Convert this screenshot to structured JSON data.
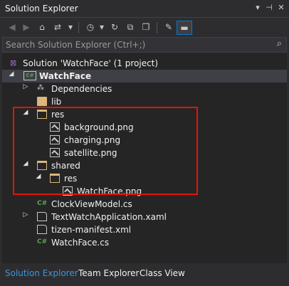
{
  "window": {
    "title": "Solution Explorer",
    "controls": [
      "▾",
      "⊣",
      "✕"
    ]
  },
  "toolbar": {
    "buttons": [
      "back-icon",
      "forward-icon",
      "home-icon",
      "sync-icon",
      "history-icon",
      "undo-icon",
      "collapse-all-icon",
      "copy-icon",
      "show-all-icon",
      "properties-icon",
      "preview-icon"
    ]
  },
  "search": {
    "placeholder": "Search Solution Explorer (Ctrl+;)",
    "icon": "search-icon"
  },
  "tree": {
    "solution": "Solution 'WatchFace' (1 project)",
    "project": "WatchFace",
    "dependencies": "Dependencies",
    "lib": "lib",
    "res": "res",
    "background": "background.png",
    "charging": "charging.png",
    "satellite": "satellite.png",
    "shared": "shared",
    "shared_res": "res",
    "shared_watchface": "WatchFace.png",
    "clockviewmodel": "ClockViewModel.cs",
    "textwatchapp": "TextWatchApplication.xaml",
    "manifest": "tizen-manifest.xml",
    "watchface_cs": "WatchFace.cs",
    "cs_badge": "C#"
  },
  "bottom_tabs": {
    "solution_explorer": "Solution Explorer",
    "team_explorer": "Team Explorer",
    "class_view": "Class View"
  },
  "colors": {
    "accent": "#007acc",
    "highlight_box": "#e51400",
    "folder": "#dcb67a",
    "csharp": "#57a64a"
  }
}
